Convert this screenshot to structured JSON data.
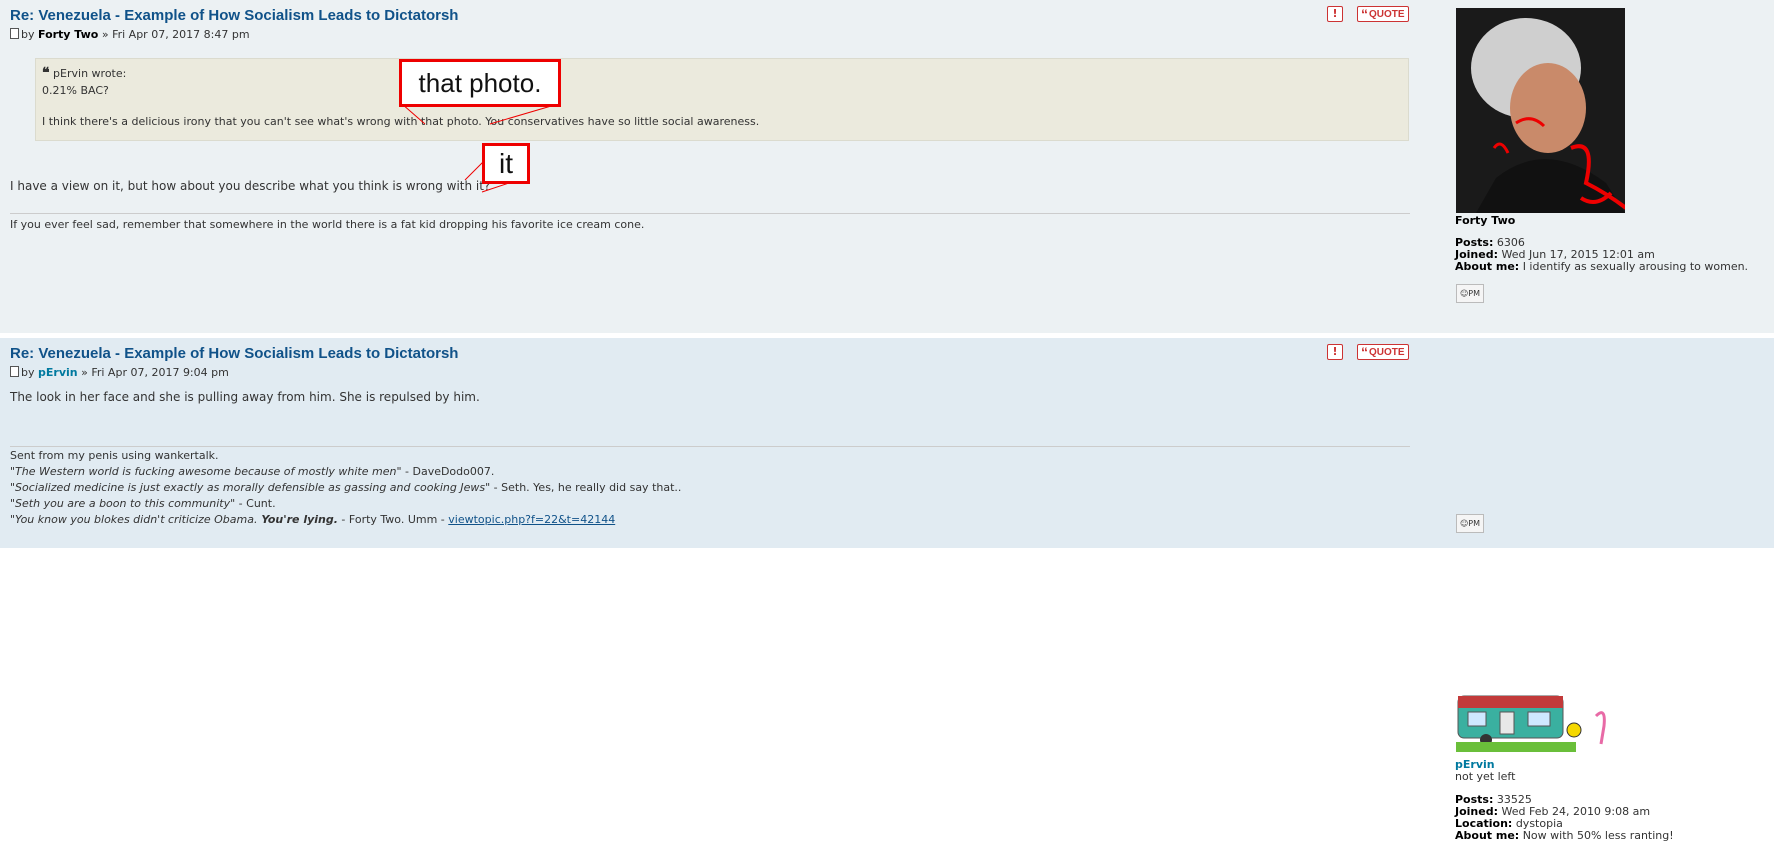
{
  "posts": [
    {
      "title": "Re: Venezuela - Example of How Socialism Leads to Dictatorsh",
      "by": "by",
      "author": "Forty Two",
      "sep": "»",
      "date": "Fri Apr 07, 2017 8:47 pm",
      "report_label": "!",
      "quote_label": "QUOTE",
      "quote": {
        "author_line": "pErvin wrote:",
        "line1": "0.21% BAC?",
        "line2": "I think there's a delicious irony that you can't see what's wrong with that photo. You conservatives have so little social awareness."
      },
      "body": "I have a view on it, but how about you describe what you think is wrong with it?",
      "signature": "If you ever feel sad, remember that somewhere in the world there is a fat kid dropping his favorite ice cream cone.",
      "callouts": [
        "that photo.",
        "it"
      ],
      "profile": {
        "name": "Forty Two",
        "rank": "",
        "posts_label": "Posts:",
        "posts": "6306",
        "joined_label": "Joined:",
        "joined": "Wed Jun 17, 2015 12:01 am",
        "about_label": "About me:",
        "about": "I identify as sexually arousing to women.",
        "pm_label": "PM"
      }
    },
    {
      "title": "Re: Venezuela - Example of How Socialism Leads to Dictatorsh",
      "by": "by",
      "author": "pErvin",
      "sep": "»",
      "date": "Fri Apr 07, 2017 9:04 pm",
      "report_label": "!",
      "quote_label": "QUOTE",
      "body": "The look in her face and she is pulling away from him. She is repulsed by him.",
      "signature": {
        "line1": "Sent from my penis using wankertalk.",
        "line2_quote": "\"The Western world is fucking awesome because of mostly white men\"",
        "line2_rest": " - DaveDodo007.",
        "line3_quote": "\"Socialized medicine is just exactly as morally defensible as gassing and cooking Jews\"",
        "line3_rest": " - Seth. Yes, he really did say that..",
        "line4_quote": "\"Seth you are a boon to this community\"",
        "line4_rest": " - Cunt.",
        "line5_quote": "\"You know you blokes didn't criticize Obama.",
        "line5_bold": " You're lying.",
        "line5_rest": " - Forty Two. Umm - ",
        "line5_link": "viewtopic.php?f=22&t=42144"
      },
      "profile": {
        "name": "pErvin",
        "rank": "not yet left",
        "posts_label": "Posts:",
        "posts": "33525",
        "joined_label": "Joined:",
        "joined": "Wed Feb 24, 2010 9:08 am",
        "location_label": "Location:",
        "location": "dystopia",
        "about_label": "About me:",
        "about": "Now with 50% less ranting!",
        "pm_label": "PM"
      }
    }
  ],
  "colors": {
    "title": "#105289",
    "accent_red": "#cc3333",
    "post1_bg": "#ecf1f3",
    "post2_bg": "#e1ebf2"
  }
}
